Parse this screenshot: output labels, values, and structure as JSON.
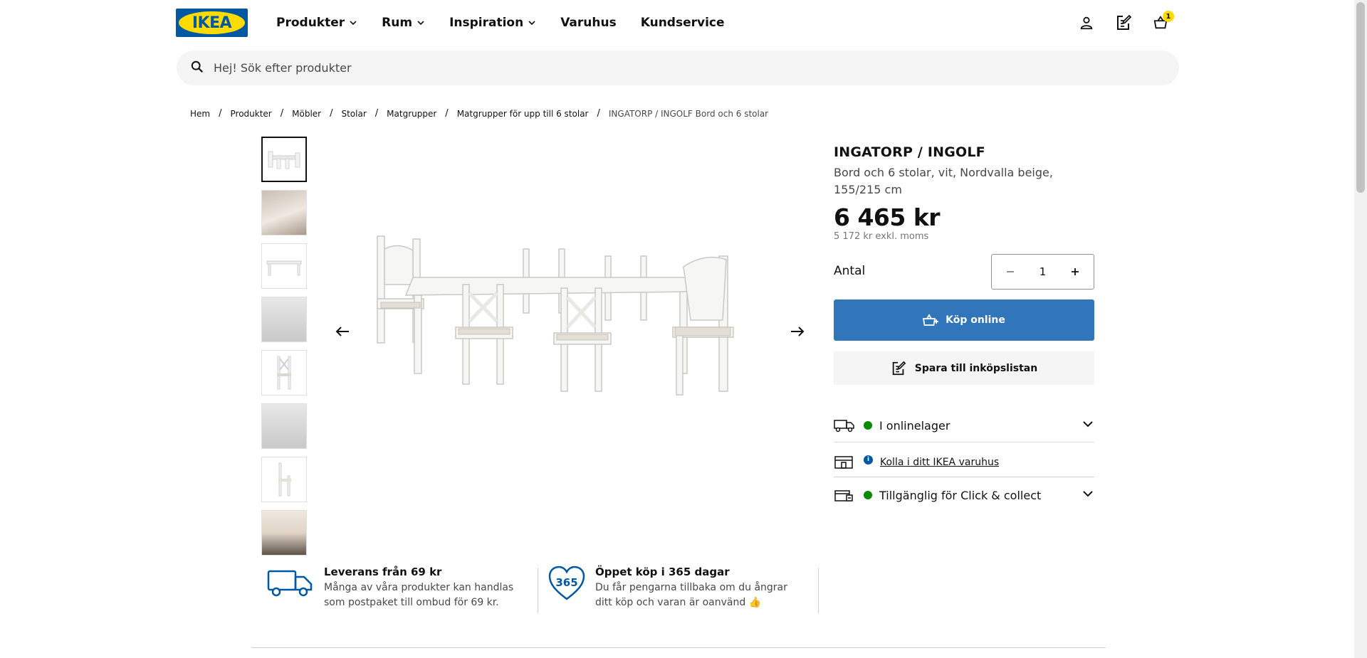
{
  "brand": {
    "logo_text": "IKEA",
    "blue": "#0058a3",
    "yellow": "#ffdb00"
  },
  "nav": [
    {
      "label": "Produkter",
      "dropdown": true
    },
    {
      "label": "Rum",
      "dropdown": true
    },
    {
      "label": "Inspiration",
      "dropdown": true
    },
    {
      "label": "Varuhus",
      "dropdown": false
    },
    {
      "label": "Kundservice",
      "dropdown": false
    }
  ],
  "header_icons": [
    "user-icon",
    "shopping-list-icon",
    "cart-icon"
  ],
  "cart": {
    "count": "1"
  },
  "search": {
    "placeholder": "Hej! Sök efter produkter"
  },
  "breadcrumb": [
    "Hem",
    "Produkter",
    "Möbler",
    "Stolar",
    "Matgrupper",
    "Matgrupper för upp till 6 stolar",
    "INGATORP / INGOLF Bord och 6 stolar"
  ],
  "gallery": {
    "thumbnail_count": 8,
    "active_index": 0
  },
  "product": {
    "name": "INGATORP / INGOLF",
    "description": "Bord och 6 stolar, vit, Nordvalla beige, 155/215 cm",
    "price": "6 465 kr",
    "price_ex_vat": "5 172 kr exkl. moms"
  },
  "quantity": {
    "label": "Antal",
    "value": "1"
  },
  "actions": {
    "buy_label": "Köp online",
    "save_label": "Spara till inköpslistan"
  },
  "availability": {
    "online": "I onlinelager",
    "store_link": "Kolla i ditt IKEA varuhus",
    "click_collect": "Tillgänglig för Click & collect",
    "status_color": "#0a8a00"
  },
  "benefits": {
    "delivery": {
      "title": "Leverans från 69 kr",
      "text": "Många av våra produkter kan handlas som postpaket till ombud för 69 kr."
    },
    "returns": {
      "title": "Öppet köp i 365 dagar",
      "text": "Du får pengarna tillbaka om du ångrar ditt köp och varan är oanvänd 👍",
      "badge": "365"
    }
  },
  "buy_button_color": "#3175bb"
}
